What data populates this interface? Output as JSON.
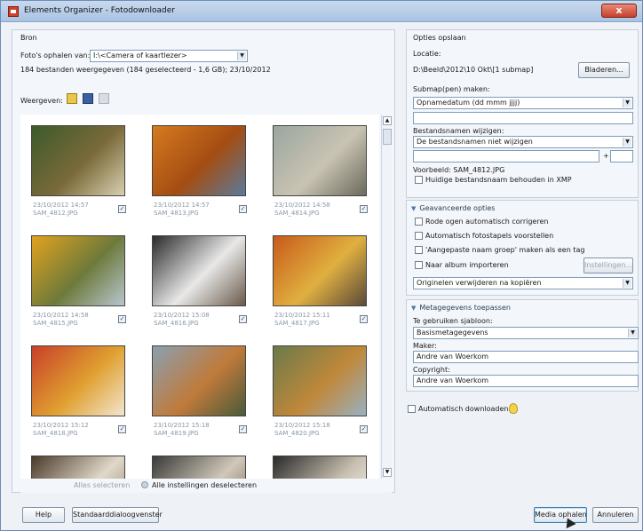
{
  "window": {
    "title": "Elements Organizer - Fotodownloader",
    "close_label": "x"
  },
  "source": {
    "section_label": "Bron",
    "fetch_label": "Foto's ophalen van:",
    "fetch_value": "I:\\<Camera of kaartlezer>",
    "summary": "184 bestanden weergegeven (184 geselecteerd - 1,6 GB); 23/10/2012",
    "view_label": "Weergeven:",
    "view_icons": [
      "image-view-icon",
      "video-view-icon",
      "audio-view-icon"
    ]
  },
  "photos": [
    {
      "date": "23/10/2012 14:57",
      "file": "SAM_4812.JPG",
      "checked": "✓",
      "colors": [
        "#3c5a2a",
        "#7a6a3a",
        "#d8d0b0"
      ]
    },
    {
      "date": "23/10/2012 14:57",
      "file": "SAM_4813.JPG",
      "checked": "✓",
      "colors": [
        "#d57a1f",
        "#a44d12",
        "#5b7a9a"
      ]
    },
    {
      "date": "23/10/2012 14:58",
      "file": "SAM_4814.JPG",
      "checked": "✓",
      "colors": [
        "#9aa6a0",
        "#c9c3b2",
        "#6b6a5c"
      ]
    },
    {
      "date": "23/10/2012 14:58",
      "file": "SAM_4815.JPG",
      "checked": "✓",
      "colors": [
        "#e2a21f",
        "#6d7a3a",
        "#b8c6cf"
      ]
    },
    {
      "date": "23/10/2012 15:08",
      "file": "SAM_4816.JPG",
      "checked": "✓",
      "colors": [
        "#2a2a2a",
        "#e8e8e8",
        "#6a5a4a"
      ]
    },
    {
      "date": "23/10/2012 15:11",
      "file": "SAM_4817.JPG",
      "checked": "✓",
      "colors": [
        "#c85a1a",
        "#e0b040",
        "#5a4a3a"
      ]
    },
    {
      "date": "23/10/2012 15:12",
      "file": "SAM_4818.JPG",
      "checked": "✓",
      "colors": [
        "#c8402a",
        "#e0a030",
        "#f2e6d0"
      ]
    },
    {
      "date": "23/10/2012 15:18",
      "file": "SAM_4819.JPG",
      "checked": "✓",
      "colors": [
        "#8aa0b0",
        "#c07a3a",
        "#4a5a3a"
      ]
    },
    {
      "date": "23/10/2012 15:18",
      "file": "SAM_4820.JPG",
      "checked": "✓",
      "colors": [
        "#6a7a4a",
        "#c0883a",
        "#9ab0c0"
      ]
    },
    {
      "date": "",
      "file": "",
      "checked": "",
      "colors": [
        "#4a3a2a",
        "#e0d8c8",
        "#8a7a6a"
      ]
    },
    {
      "date": "",
      "file": "",
      "checked": "",
      "colors": [
        "#3a3a3a",
        "#d0c8b8",
        "#6a5a4a"
      ]
    },
    {
      "date": "",
      "file": "",
      "checked": "",
      "colors": [
        "#2a2a2a",
        "#c8c0b0",
        "#ffffff"
      ]
    }
  ],
  "selection": {
    "select_all": "Alles selecteren",
    "deselect_all": "Alle instellingen deselecteren"
  },
  "save_options": {
    "section_label": "Opties opslaan",
    "location_label": "Locatie:",
    "location_value": "D:\\Beeld\\2012\\10 Okt\\[1 submap]",
    "browse_button": "Bladeren...",
    "subfolder_label": "Submap(pen) maken:",
    "subfolder_value": "Opnamedatum (dd mmm jjjj)",
    "rename_label": "Bestandsnamen wijzigen:",
    "rename_value": "De bestandsnamen niet wijzigen",
    "plus_sign": "+",
    "example_label": "Voorbeeld: SAM_4812.JPG",
    "keep_name_label": "Huidige bestandsnaam behouden in XMP"
  },
  "advanced": {
    "section_label": "Geavanceerde opties",
    "red_eye": "Rode ogen automatisch corrigeren",
    "stacks": "Automatisch fotostapels voorstellen",
    "group_tag": "'Aangepaste naam groep' maken als een tag",
    "album_import": "Naar album importeren",
    "settings_button": "Instellingen...",
    "delete_value": "Originelen verwijderen na kopiëren"
  },
  "metadata": {
    "section_label": "Metagegevens toepassen",
    "template_label": "Te gebruiken sjabloon:",
    "template_value": "Basismetagegevens",
    "creator_label": "Maker:",
    "creator_value": "Andre van Woerkom",
    "copyright_label": "Copyright:",
    "copyright_value": "Andre van Woerkom"
  },
  "auto_download": {
    "label": "Automatisch downloaden",
    "icon": "lightbulb-icon"
  },
  "footer": {
    "help": "Help",
    "standard_dialog": "Standaarddialoogvenster",
    "get_media": "Media ophalen",
    "cancel": "Annuleren"
  },
  "colors": {
    "accent": "#4b77a8",
    "title_gradient_top": "#c9daee",
    "title_gradient_bottom": "#a9c3e2"
  }
}
